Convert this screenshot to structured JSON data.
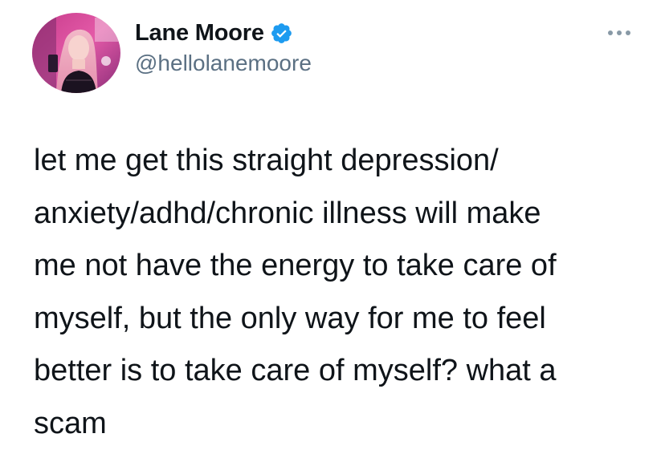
{
  "tweet": {
    "author": {
      "display_name": "Lane Moore",
      "handle": "@hellolanemoore",
      "verified_icon": "verified-badge-icon",
      "avatar_icon": "profile-photo"
    },
    "more_icon": "more-options-icon",
    "text": "let me get this straight depression/\nanxiety/adhd/chronic illness will make\nme not have the energy to take care of\nmyself, but the only way for me to feel\nbetter is to take care of myself? what a\nscam"
  },
  "colors": {
    "text": "#0f1419",
    "secondary": "#5b7083",
    "verified": "#1d9bf0",
    "background": "#ffffff"
  }
}
